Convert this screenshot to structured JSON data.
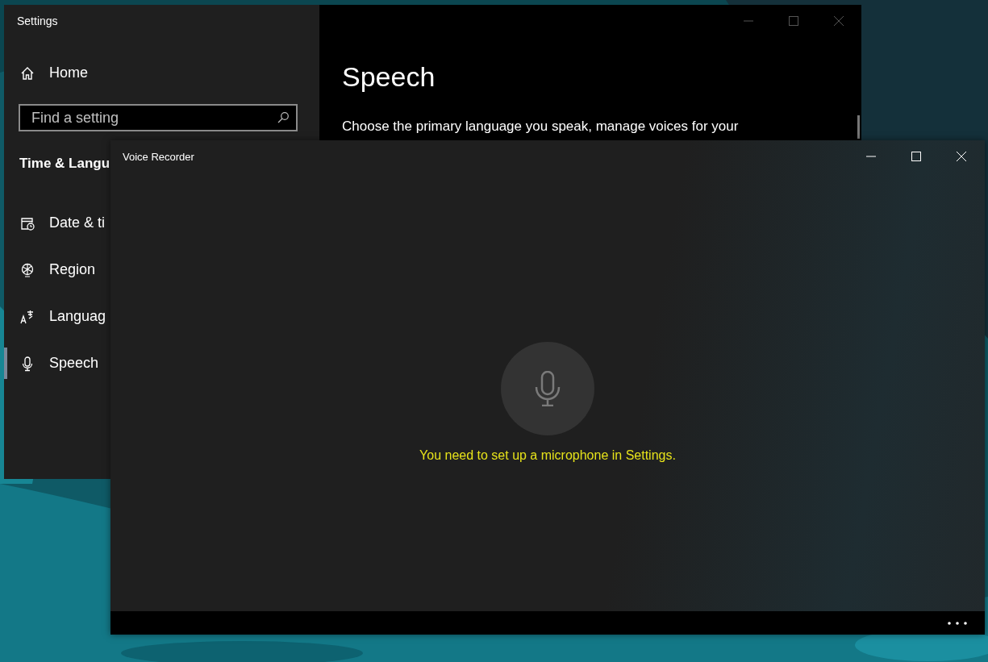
{
  "settings": {
    "title": "Settings",
    "home": {
      "label": "Home"
    },
    "search": {
      "placeholder": "Find a setting"
    },
    "section_title": "Time & Langu",
    "nav": [
      {
        "kind": "date",
        "label": "Date & ti",
        "selected": false
      },
      {
        "kind": "region",
        "label": "Region",
        "selected": false
      },
      {
        "kind": "language",
        "label": "Languag",
        "selected": false
      },
      {
        "kind": "speech",
        "label": "Speech",
        "selected": true
      }
    ],
    "page_title": "Speech",
    "description": "Choose the primary language you speak, manage voices for your"
  },
  "voice_recorder": {
    "title": "Voice Recorder",
    "message": "You need to set up a microphone in Settings."
  }
}
